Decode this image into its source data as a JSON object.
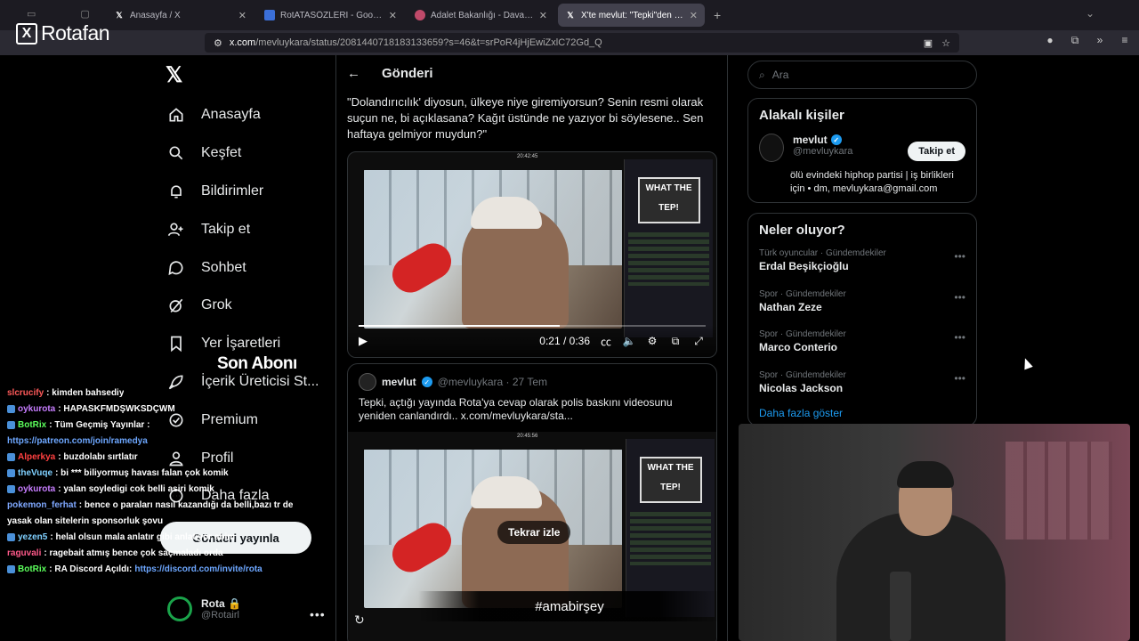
{
  "browser": {
    "tabs": [
      {
        "title": "Anasayfa / X",
        "icon": "x-icon",
        "active": false
      },
      {
        "title": "RotATASÖZLERİ - Google Dokü",
        "icon": "docs-icon",
        "active": false
      },
      {
        "title": "Adalet Bakanlığı - Dava Dosyası",
        "icon": "gov-icon",
        "active": false
      },
      {
        "title": "X'te mevlut: \"Tepki\"den Rota'ya",
        "icon": "x-icon",
        "active": true
      }
    ],
    "url_host": "x.com",
    "url_path": "/mevluykara/status/2081440718183133659?s=46&t=srPoR4jHjEwiZxlC72Gd_Q"
  },
  "stream_logo": "Rotafan",
  "nav": {
    "items": [
      {
        "label": "Anasayfa",
        "icon": "home-icon"
      },
      {
        "label": "Keşfet",
        "icon": "search-icon"
      },
      {
        "label": "Bildirimler",
        "icon": "bell-icon"
      },
      {
        "label": "Takip et",
        "icon": "person-add-icon"
      },
      {
        "label": "Sohbet",
        "icon": "chat-icon"
      },
      {
        "label": "Grok",
        "icon": "grok-icon"
      },
      {
        "label": "Yer İşaretleri",
        "icon": "bookmark-icon"
      },
      {
        "label": "İçerik Üreticisi St...",
        "icon": "rocket-icon"
      },
      {
        "label": "Premium",
        "icon": "premium-icon"
      },
      {
        "label": "Profil",
        "icon": "profile-icon"
      },
      {
        "label": "Daha fazla",
        "icon": "more-icon"
      }
    ],
    "post_button": "Gönderi yayınla",
    "user_name": "Rota",
    "user_handle": "@Rotairl"
  },
  "main": {
    "header_title": "Gönderi",
    "quote": "\"Dolandırıcılık' diyosun, ülkeye niye giremiyorsun? Senin resmi olarak suçun ne, bi açıklasana? Kağıt üstünde ne yazıyor bi söylesene.. Sen haftaya gelmiyor muydun?\"",
    "video1": {
      "top_time": "20:42:45",
      "time": "0:21 / 0:36",
      "progress": 0.58,
      "panel_title": "WHAT THE TEP!"
    },
    "qt": {
      "name": "mevlut",
      "handle": "@mevluykara · 27 Tem",
      "text": "Tepki, açtığı yayında Rota'ya cevap olarak polis baskını videosunu yeniden canlandırdı..  x.com/mevluykara/sta..."
    },
    "video2": {
      "top_time": "20:45:56",
      "replay": "Tekrar izle",
      "panel_title": "WHAT THE TEP!"
    },
    "hashtag": "#amabirşey"
  },
  "right": {
    "search_placeholder": "Ara",
    "related_title": "Alakalı kişiler",
    "related": {
      "name": "mevlut",
      "handle": "@mevluykara",
      "bio": "ölü evindeki hiphop partisi | iş birlikleri için • dm, mevluykara@gmail.com",
      "follow": "Takip et"
    },
    "trends_title": "Neler oluyor?",
    "trends": [
      {
        "meta": "Türk oyuncular · Gündemdekiler",
        "name": "Erdal Beşikçioğlu"
      },
      {
        "meta": "Spor · Gündemdekiler",
        "name": "Nathan Zeze"
      },
      {
        "meta": "Spor · Gündemdekiler",
        "name": "Marco Conterio"
      },
      {
        "meta": "Spor · Gündemdekiler",
        "name": "Nicolas Jackson"
      }
    ],
    "show_more": "Daha fazla göster"
  },
  "overlay": {
    "banner": "Son Abonı",
    "chat": [
      {
        "user": "slcrucify",
        "color": "#ff5a5a",
        "msg": ": kimden bahsediy",
        "badge": false
      },
      {
        "user": "oykurota",
        "color": "#c77dff",
        "msg": ": HAPASKFMDŞWKSDÇWM",
        "badge": true
      },
      {
        "user": "BotRix",
        "color": "#5cff5c",
        "msg": ": Tüm Geçmiş Yayınlar :",
        "badge": true
      },
      {
        "user": "",
        "color": "#6da7ff",
        "msg": "https://patreon.com/join/ramedya",
        "badge": false,
        "link": true
      },
      {
        "user": "Alperkya",
        "color": "#ff4040",
        "msg": ": buzdolabı sırtlatır",
        "badge": true
      },
      {
        "user": "theVuqe",
        "color": "#7fd0ff",
        "msg": ": bi *** biliyormuş havası falan çok komik",
        "badge": true
      },
      {
        "user": "oykurota",
        "color": "#c77dff",
        "msg": ": yalan soyledigi cok belli asiri komik",
        "badge": true
      },
      {
        "user": "pokemon_ferhat",
        "color": "#7fa8ff",
        "msg": ": bence o paraları nasıl kazandığı da belli,bazı tr de",
        "badge": false
      },
      {
        "user": "",
        "color": "#ffffff",
        "msg": "yasak olan sitelerin sponsorluk şovu",
        "badge": false
      },
      {
        "user": "yezen5",
        "color": "#7fd0ff",
        "msg": ": helal olsun mala anlatır gibi anlatıyor abim",
        "badge": true
      },
      {
        "user": "raguvali",
        "color": "#ff5a8a",
        "msg": ": ragebait atmış bence çok saçmaladı orda",
        "badge": false
      },
      {
        "user": "BotRix",
        "color": "#5cff5c",
        "msg": ": RA Discord Açıldı: ",
        "badge": true,
        "tail": "https://discord.com/invite/rota"
      }
    ]
  }
}
